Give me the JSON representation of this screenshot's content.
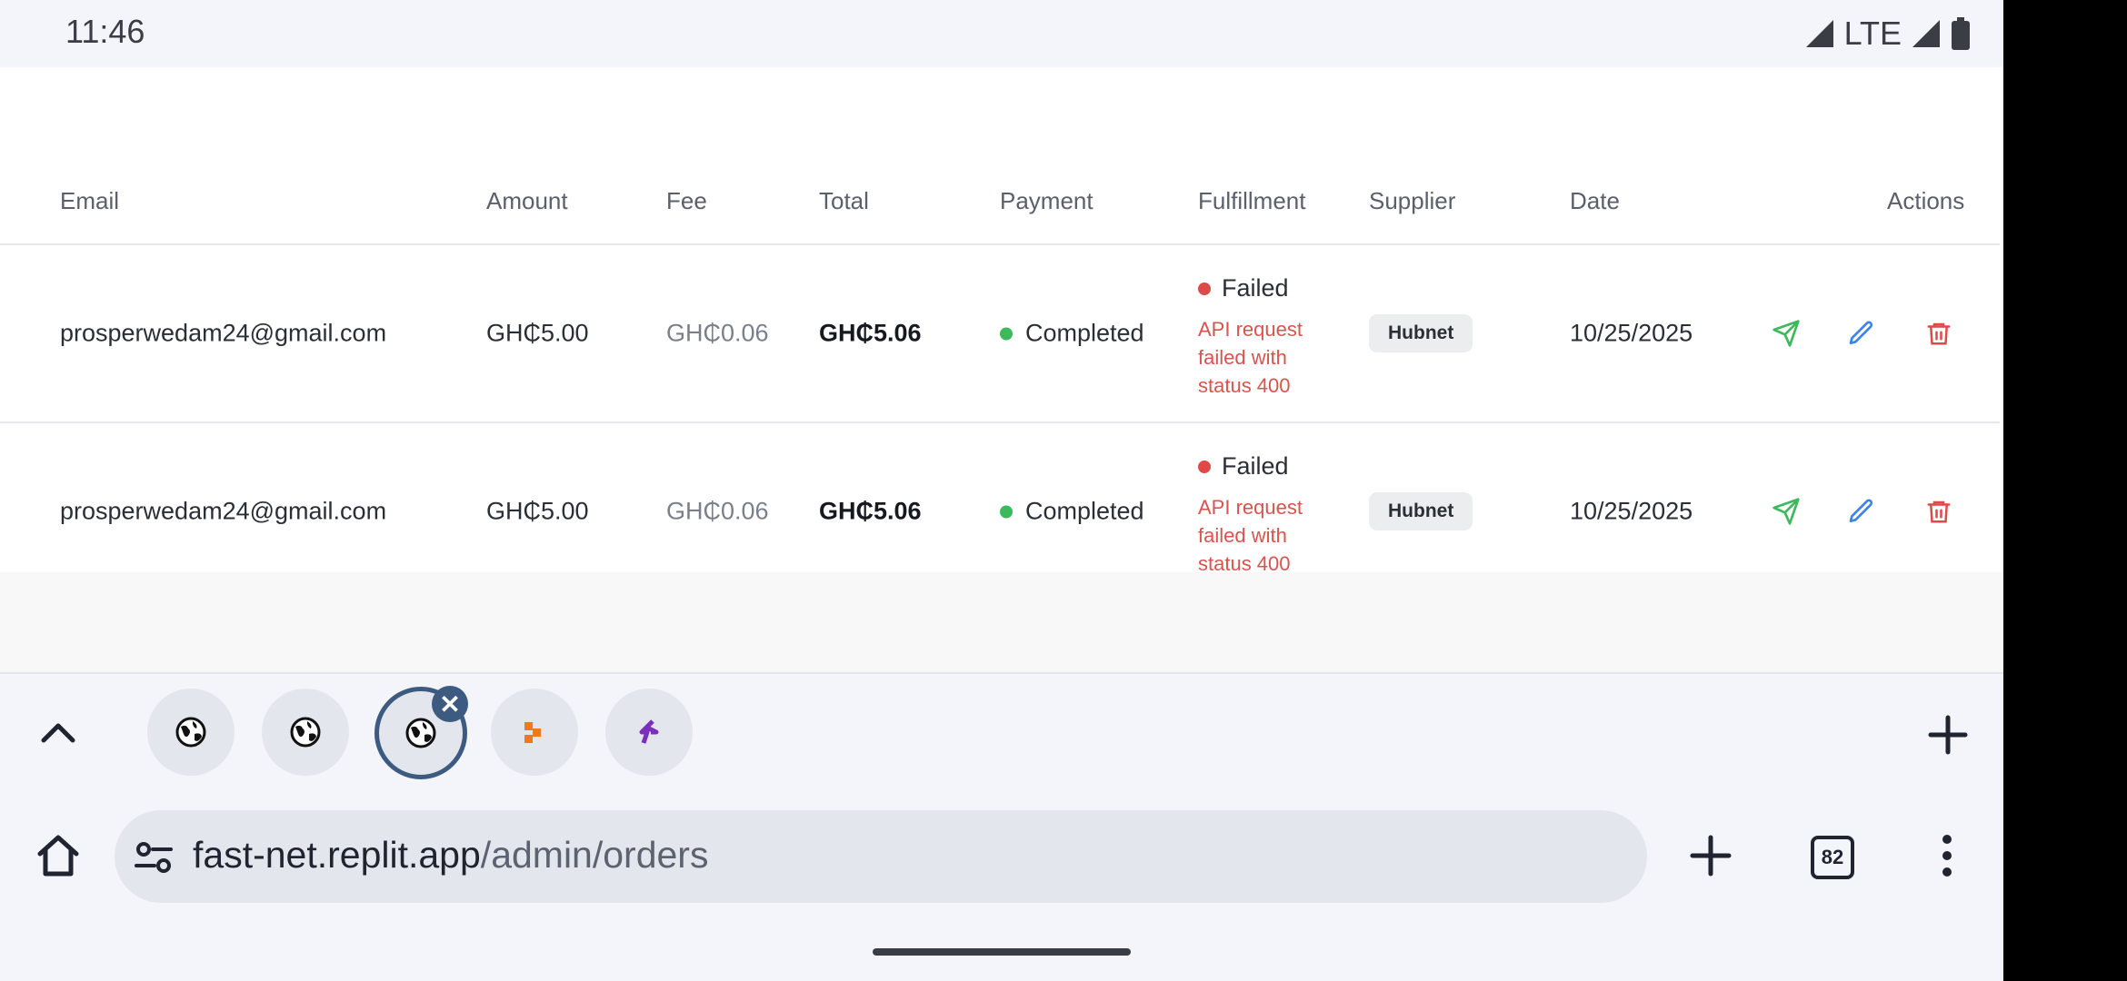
{
  "status_bar": {
    "time": "11:46",
    "network": "LTE"
  },
  "table": {
    "headers": [
      "Email",
      "Amount",
      "Fee",
      "Total",
      "Payment",
      "Fulfillment",
      "Supplier",
      "Date",
      "Actions"
    ],
    "rows": [
      {
        "email": "prosperwedam24@gmail.com",
        "amount": "GH₵5.00",
        "fee": "GH₵0.06",
        "total": "GH₵5.06",
        "payment": "Completed",
        "fulfillment": "Failed",
        "fulfillment_error": "API request failed with status 400",
        "supplier": "Hubnet",
        "date": "10/25/2025"
      },
      {
        "email": "prosperwedam24@gmail.com",
        "amount": "GH₵5.00",
        "fee": "GH₵0.06",
        "total": "GH₵5.06",
        "payment": "Completed",
        "fulfillment": "Failed",
        "fulfillment_error": "API request failed with status 400",
        "supplier": "Hubnet",
        "date": "10/25/2025"
      }
    ],
    "action_icons": [
      "send-icon",
      "pencil-icon",
      "trash-icon"
    ]
  },
  "browser": {
    "tabs": [
      {
        "icon": "globe-icon"
      },
      {
        "icon": "globe-icon"
      },
      {
        "icon": "globe-icon",
        "active": true
      },
      {
        "icon": "orange-logo-icon"
      },
      {
        "icon": "purple-logo-icon"
      }
    ],
    "url_host": "fast-net.replit.app",
    "url_path": "/admin/orders",
    "tab_count": "82"
  },
  "colors": {
    "success": "#3cb95a",
    "danger": "#dd4a48",
    "edit": "#3b82f6",
    "active_tab": "#3d5a80"
  }
}
